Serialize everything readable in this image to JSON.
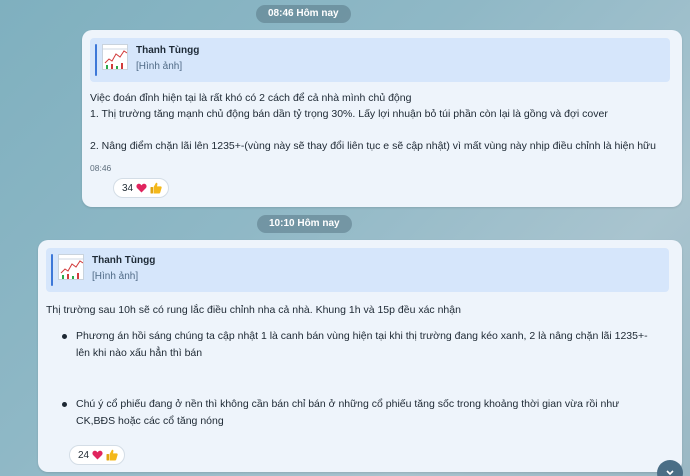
{
  "dates": {
    "first": "08:46 Hôm nay",
    "second": "10:10 Hôm nay"
  },
  "message1": {
    "quote": {
      "name": "Thanh Tùngg",
      "subtitle": "[Hình ảnh]"
    },
    "lines": [
      "Việc đoán đỉnh hiện tại là rất khó có 2 cách để cả nhà mình chủ động",
      "1. Thị trường tăng mạnh chủ động bán dần tỷ trọng 30%. Lấy lợi nhuận bỏ túi phần còn lại là gồng và đợi cover",
      "",
      "2. Nâng điểm chặn lãi lên 1235+-(vùng này sẽ thay đổi liên tục e sẽ cập nhật) vì mất vùng này nhịp điều chỉnh là hiện hữu"
    ],
    "time": "08:46",
    "reactions": {
      "count": "34",
      "icons": [
        "heart-icon",
        "thumbs-up-icon"
      ]
    }
  },
  "message2": {
    "quote": {
      "name": "Thanh Tùngg",
      "subtitle": "[Hình ảnh]"
    },
    "intro": "Thị trường sau 10h sẽ có rung lắc điều chỉnh nha cả nhà. Khung 1h và 15p đều xác nhận",
    "bullets": [
      {
        "line1": "Phương án hồi sáng chúng ta cập nhật 1 là canh bán vùng hiện tại khi thị trường đang kéo xanh, 2 là nâng chặn lãi 1235+-",
        "line2": "lên khi nào xấu hẳn thì bán"
      },
      {
        "line1": "Chú ý cổ phiếu đang ở nền thì không cần bán chỉ bán ở những cổ phiếu tăng sốc trong khoảng thời gian vừa rồi như",
        "line2": "CK,BĐS hoặc các cổ tăng nóng"
      }
    ],
    "reactions": {
      "count": "24",
      "icons": [
        "heart-icon",
        "thumbs-up-icon"
      ]
    }
  },
  "colors": {
    "accent": "#3d78d8",
    "bubble": "#eef4fb",
    "quote_bg": "#d6e6fb",
    "heart": "#e0245e",
    "thumb": "#f4b81a"
  }
}
